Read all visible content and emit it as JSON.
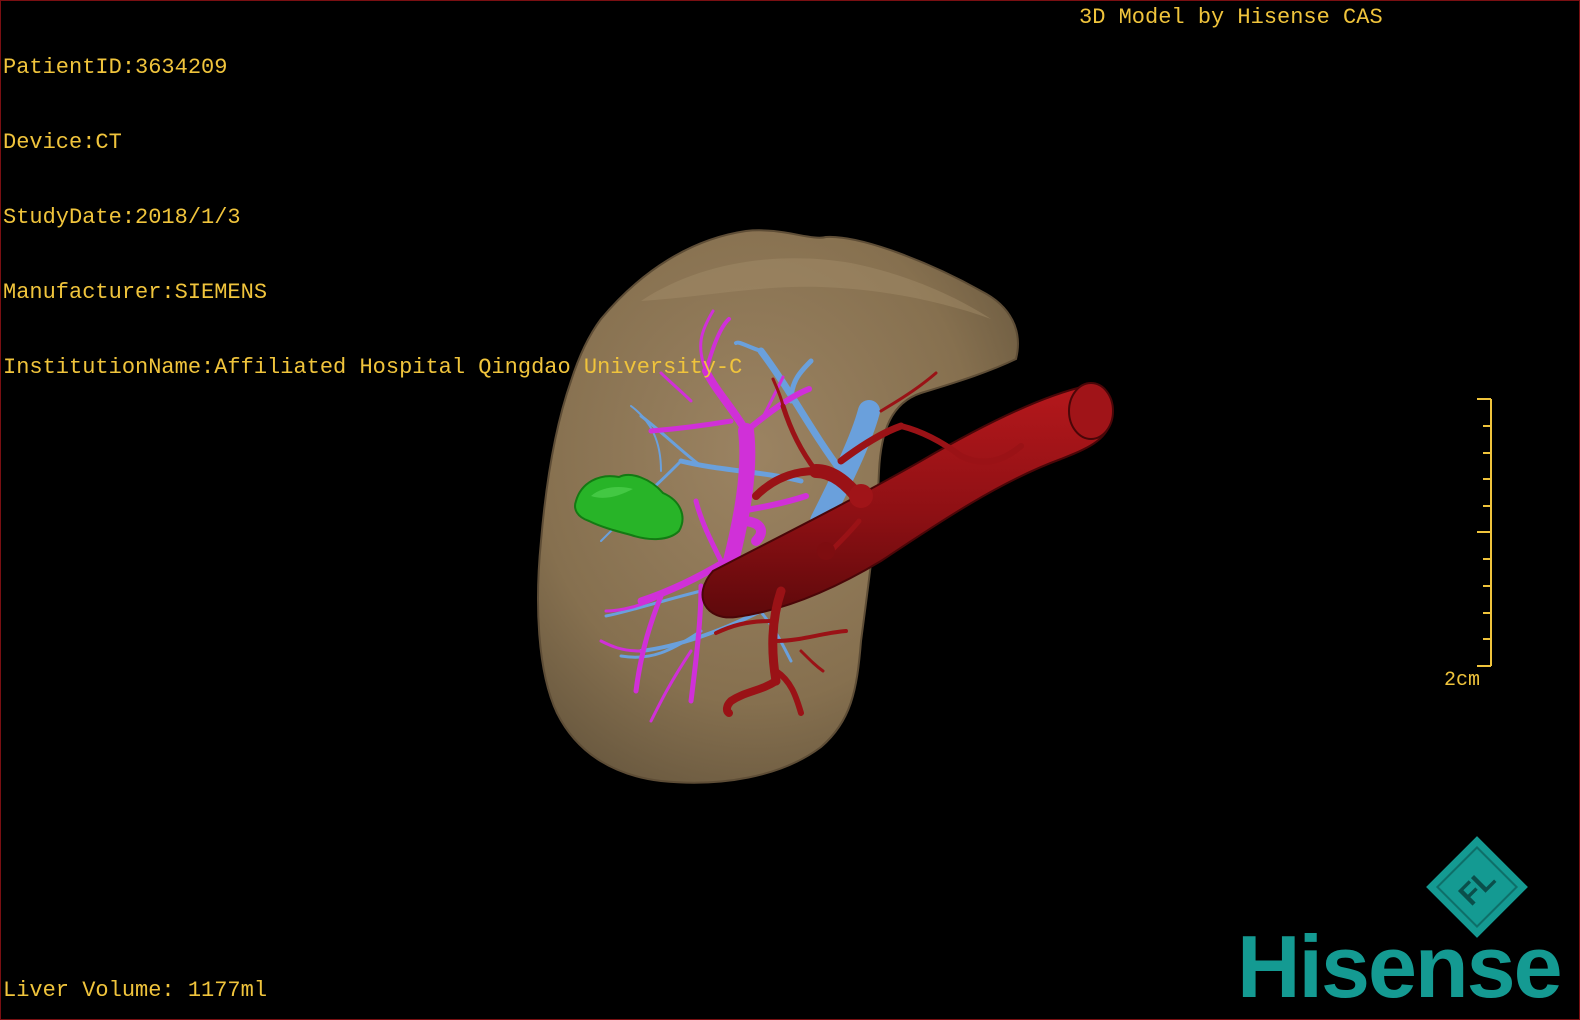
{
  "patient": {
    "id_line": "PatientID:3634209",
    "device_line": "Device:CT",
    "study_date_line": "StudyDate:2018/1/3",
    "manufacturer_line": "Manufacturer:SIEMENS",
    "institution_line": "InstitutionName:Affiliated Hospital Qingdao University-C"
  },
  "model_credit": "3D Model by Hisense CAS",
  "measurements": {
    "liver_volume_line": "Liver Volume: 1177ml",
    "scale_label": "2cm"
  },
  "brand": {
    "name": "Hisense",
    "logo_letters": "FL",
    "color": "#149a92"
  },
  "colors": {
    "overlay_text": "#f0c43c",
    "liver": "#8c7354",
    "portal_vein": "#d030d8",
    "hepatic_vein": "#6aa0dc",
    "artery": "#9a1216",
    "lesion": "#28b428",
    "frame_border": "#7a0f12"
  },
  "icons": {
    "logo": "hisense-fl-diamond-logo",
    "scale": "ruler-scale-bar"
  }
}
